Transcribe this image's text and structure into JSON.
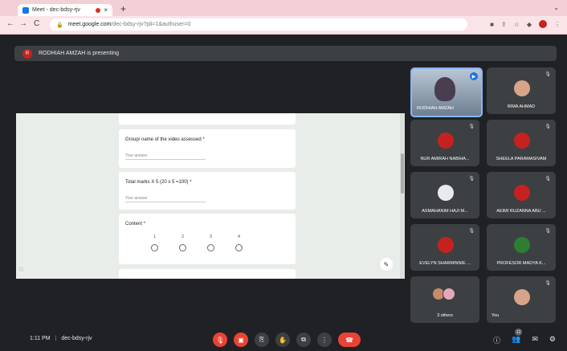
{
  "browser": {
    "tab_title": "Meet - dec-bdsy-rjv",
    "tab_close": "×",
    "new_tab": "+",
    "tab_menu": "⌄",
    "url_host": "meet.google.com",
    "url_path": "/dec-bdsy-rjv?pli=1&authuser=0",
    "back": "←",
    "forward": "→",
    "reload": "C"
  },
  "presentation_banner": {
    "avatar_letter": "R",
    "text": "RODHIAH AMZAH is presenting"
  },
  "form": {
    "q1": "Group/ name of the video assessed *",
    "q1_answer": "Your answer",
    "q2": "Total marks X 5 (20 x 5 =100) *",
    "q2_answer": "Your answer",
    "q3": "Content *",
    "scale": [
      "1",
      "2",
      "3",
      "4"
    ]
  },
  "participants": [
    {
      "name": "RODHIAH AMZAH",
      "color": "#4a3d4f"
    },
    {
      "name": "IRMA AHMAD",
      "color": "#d8a489"
    },
    {
      "name": "NUR AMIRAH NABIHA...",
      "color": "#c5221f"
    },
    {
      "name": "SHEELA PARAMASIVAM",
      "color": "#c5221f"
    },
    {
      "name": "ASMAHANIM HAJI M...",
      "color": "#e8eaed"
    },
    {
      "name": "AEIMI RUZANNA ABU ...",
      "color": "#c5221f"
    },
    {
      "name": "EVELYN SHARMINNIE ...",
      "color": "#c5221f"
    },
    {
      "name": "PROFESOR MADYA K...",
      "color": "#2e7d32"
    },
    {
      "name": "3 others",
      "color": "#c98a6a"
    },
    {
      "name": "You",
      "color": "#d8a489"
    }
  ],
  "meeting": {
    "time": "1:11 PM",
    "separator": "|",
    "code": "dec-bdsy-rjv",
    "people_count": "12"
  }
}
